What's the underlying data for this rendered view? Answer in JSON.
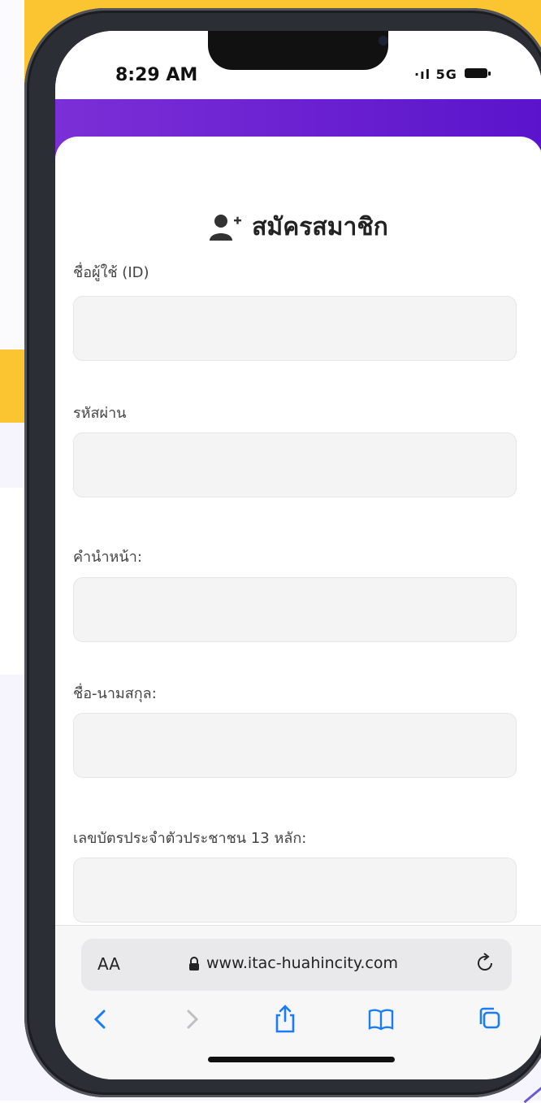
{
  "status_bar": {
    "time": "8:29 AM",
    "signal": "5G"
  },
  "form": {
    "title": "สมัครสมาชิก",
    "fields": [
      {
        "label": "ชื่อผู้ใช้ (ID)",
        "value": ""
      },
      {
        "label": "รหัสผ่าน",
        "value": ""
      },
      {
        "label": "คำนำหน้า:",
        "value": ""
      },
      {
        "label": "ชื่อ-นามสกุล:",
        "value": ""
      },
      {
        "label": "เลขบัตรประจำตัวประชาชน 13 หลัก:",
        "value": ""
      }
    ]
  },
  "browser": {
    "text_size_label": "AA",
    "url": "www.itac-huahincity.com",
    "toolbar": [
      "back-icon",
      "forward-icon",
      "share-icon",
      "bookmarks-icon",
      "tabs-icon"
    ]
  },
  "colors": {
    "brand": "#6a1fd2",
    "accent_bg": "#fbc531",
    "safari_blue": "#1a7cf6"
  }
}
